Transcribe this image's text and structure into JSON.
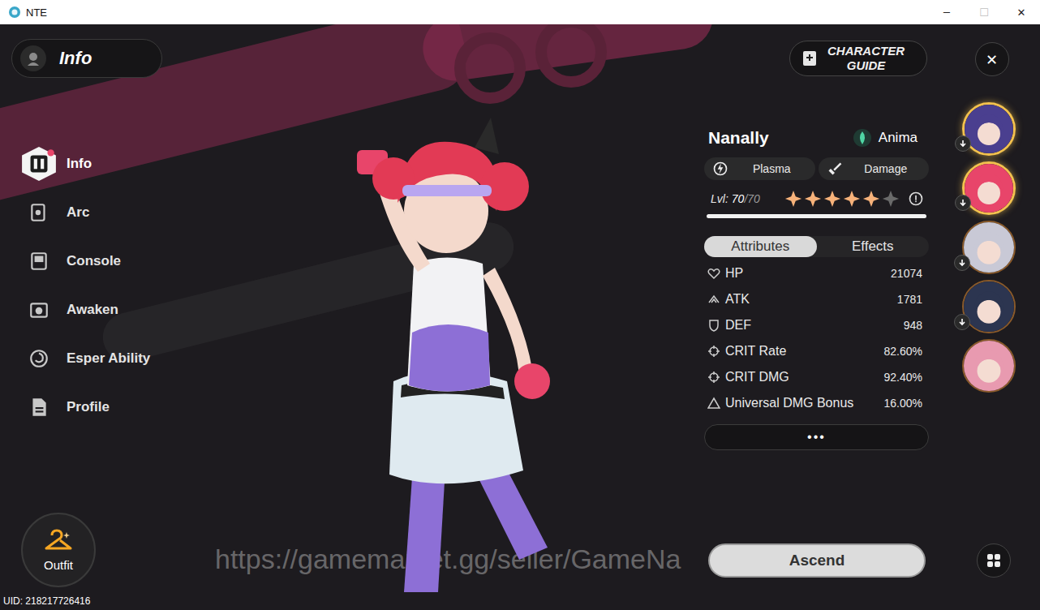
{
  "window": {
    "title": "NTE",
    "controls": [
      {
        "label": "─",
        "disabled": false
      },
      {
        "label": "☐",
        "disabled": true
      },
      {
        "label": "✕",
        "disabled": false
      }
    ]
  },
  "page_title": "Info",
  "sidebar": {
    "items": [
      {
        "label": "Info",
        "selected": true
      },
      {
        "label": "Arc",
        "selected": false
      },
      {
        "label": "Console",
        "selected": false
      },
      {
        "label": "Awaken",
        "selected": false
      },
      {
        "label": "Esper Ability",
        "selected": false
      },
      {
        "label": "Profile",
        "selected": false
      }
    ]
  },
  "guide_button": [
    "CHARACTER",
    "GUIDE"
  ],
  "close_button": "✕",
  "character": {
    "name": "Nanally",
    "element": "Anima",
    "tags": [
      "Plasma",
      "Damage"
    ],
    "level_label": "Lvl:",
    "level": "70",
    "level_max": "/70",
    "stars": 5,
    "stars_total": 6,
    "level_bar": {
      "level": 1
    }
  },
  "tabs": [
    {
      "label": "Attributes",
      "selected": true
    },
    {
      "label": "Effects",
      "selected": false
    }
  ],
  "stats": [
    {
      "label": "HP",
      "value": "21074"
    },
    {
      "label": "ATK",
      "value": "1781"
    },
    {
      "label": "DEF",
      "value": "948"
    },
    {
      "label": "CRIT Rate",
      "value": "82.60%"
    },
    {
      "label": "CRIT DMG",
      "value": "92.40%"
    },
    {
      "label": "Universal DMG Bonus",
      "value": "16.00%"
    }
  ],
  "more_button": "•••",
  "ascend_button": "Ascend",
  "outfit_button": "Outfit",
  "uid": "UID: 218217726416",
  "watermark": "https://gamemarket.gg/seller/GameNa",
  "roster": [
    {
      "highlighted": true,
      "badge": true,
      "color": "#4a3f8f"
    },
    {
      "highlighted": true,
      "badge": true,
      "color": "#e8456a"
    },
    {
      "highlighted": false,
      "badge": true,
      "color": "#c9c9d6"
    },
    {
      "highlighted": false,
      "badge": true,
      "color": "#2c3550"
    },
    {
      "highlighted": false,
      "badge": false,
      "color": "#e89ab0"
    }
  ]
}
